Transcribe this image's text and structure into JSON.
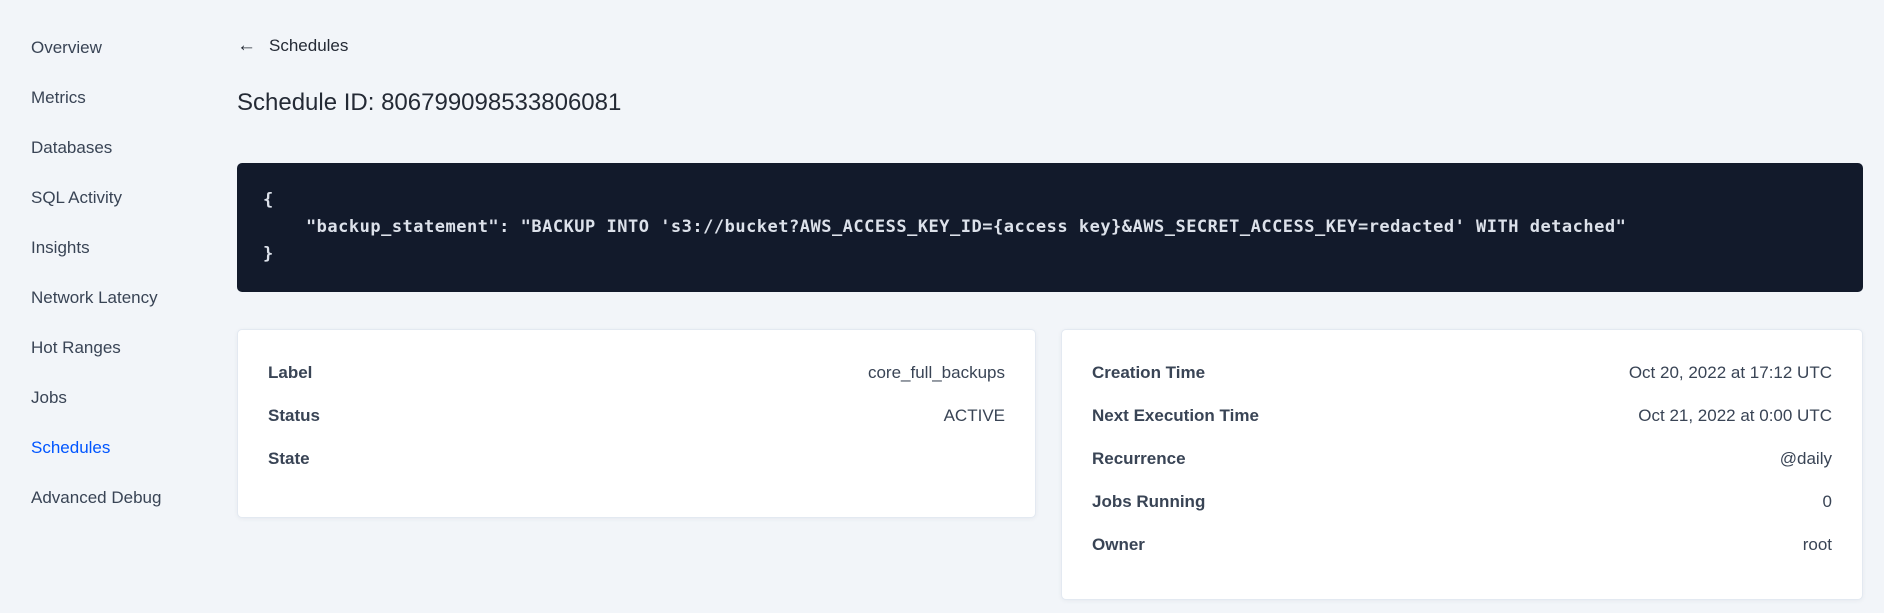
{
  "colors": {
    "accent": "#0055ff",
    "code_bg": "#121a2b",
    "page_bg": "#f2f5f9"
  },
  "sidebar": {
    "items": [
      {
        "label": "Overview",
        "active": false
      },
      {
        "label": "Metrics",
        "active": false
      },
      {
        "label": "Databases",
        "active": false
      },
      {
        "label": "SQL Activity",
        "active": false
      },
      {
        "label": "Insights",
        "active": false
      },
      {
        "label": "Network Latency",
        "active": false
      },
      {
        "label": "Hot Ranges",
        "active": false
      },
      {
        "label": "Jobs",
        "active": false
      },
      {
        "label": "Schedules",
        "active": true
      },
      {
        "label": "Advanced Debug",
        "active": false
      }
    ]
  },
  "header": {
    "back_label": "Schedules",
    "back_arrow": "←",
    "title": "Schedule ID: 806799098533806081"
  },
  "code_block": {
    "lines": [
      "{",
      "    \"backup_statement\": \"BACKUP INTO 's3://bucket?AWS_ACCESS_KEY_ID={access key}&AWS_SECRET_ACCESS_KEY=redacted' WITH detached\"",
      "}"
    ]
  },
  "details_left": {
    "rows": [
      {
        "label": "Label",
        "value": "core_full_backups"
      },
      {
        "label": "Status",
        "value": "ACTIVE"
      },
      {
        "label": "State",
        "value": ""
      }
    ]
  },
  "details_right": {
    "rows": [
      {
        "label": "Creation Time",
        "value": "Oct 20, 2022 at 17:12 UTC"
      },
      {
        "label": "Next Execution Time",
        "value": "Oct 21, 2022 at 0:00 UTC"
      },
      {
        "label": "Recurrence",
        "value": "@daily"
      },
      {
        "label": "Jobs Running",
        "value": "0"
      },
      {
        "label": "Owner",
        "value": "root"
      }
    ]
  }
}
